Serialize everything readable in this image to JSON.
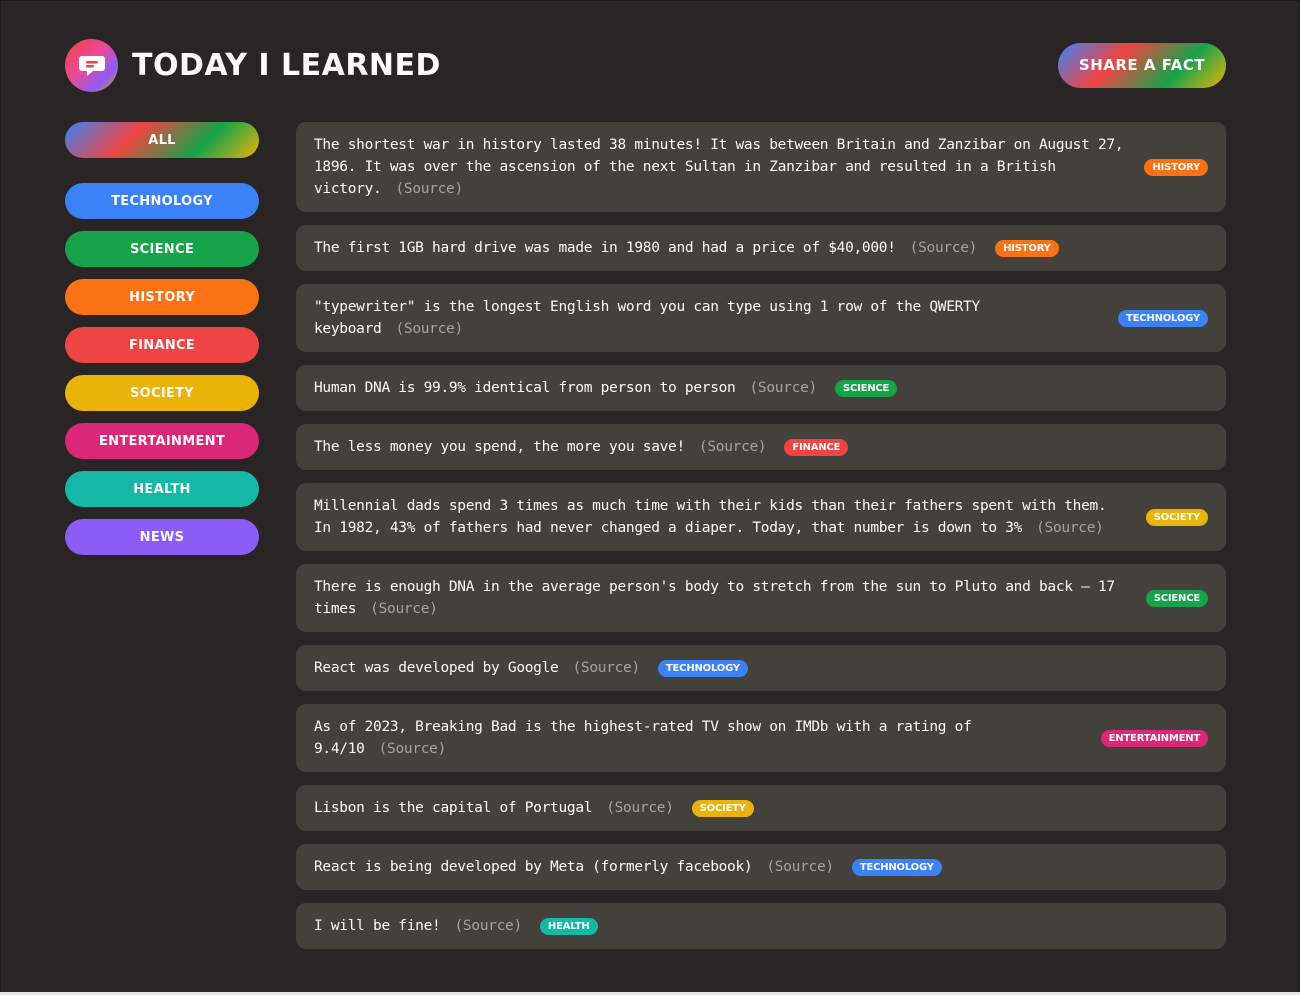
{
  "app": {
    "title": "Today I Learned",
    "share_label": "Share a fact"
  },
  "colors": {
    "background": "#292524",
    "card": "#44403c",
    "technology": "#3b82f6",
    "science": "#16a34a",
    "history": "#f97316",
    "finance": "#ef4444",
    "society": "#eab308",
    "entertainment": "#db2777",
    "health": "#14b8a6",
    "news": "#8b5cf6"
  },
  "sidebar": {
    "all_label": "All",
    "categories": [
      {
        "label": "Technology",
        "color": "#3b82f6"
      },
      {
        "label": "Science",
        "color": "#16a34a"
      },
      {
        "label": "History",
        "color": "#f97316"
      },
      {
        "label": "Finance",
        "color": "#ef4444"
      },
      {
        "label": "Society",
        "color": "#eab308"
      },
      {
        "label": "Entertainment",
        "color": "#db2777"
      },
      {
        "label": "Health",
        "color": "#14b8a6"
      },
      {
        "label": "News",
        "color": "#8b5cf6"
      }
    ]
  },
  "facts": [
    {
      "text": "The shortest war in history lasted 38 minutes! It was between Britain and Zanzibar on August 27, 1896. It was over the ascension of the next Sultan in Zanzibar and resulted in a British victory.",
      "source": "(Source)",
      "tag": "History",
      "tag_color": "#f97316",
      "inline": false
    },
    {
      "text": "The first 1GB hard drive was made in 1980 and had a price of $40,000!",
      "source": "(Source)",
      "tag": "History",
      "tag_color": "#f97316",
      "inline": true
    },
    {
      "text": "\"typewriter\" is the longest English word you can type using 1 row of the QWERTY keyboard",
      "source": "(Source)",
      "tag": "Technology",
      "tag_color": "#3b82f6",
      "inline": false
    },
    {
      "text": "Human DNA is 99.9% identical from person to person",
      "source": "(Source)",
      "tag": "Science",
      "tag_color": "#16a34a",
      "inline": true
    },
    {
      "text": "The less money you spend, the more you save!",
      "source": "(Source)",
      "tag": "Finance",
      "tag_color": "#ef4444",
      "inline": true
    },
    {
      "text": "Millennial dads spend 3 times as much time with their kids than their fathers spent with them. In 1982, 43% of fathers had never changed a diaper. Today, that number is down to 3%",
      "source": "(Source)",
      "tag": "Society",
      "tag_color": "#eab308",
      "inline": false
    },
    {
      "text": "There is enough DNA in the average person's body to stretch from the sun to Pluto and back — 17 times",
      "source": "(Source)",
      "tag": "Science",
      "tag_color": "#16a34a",
      "inline": false
    },
    {
      "text": "React was developed by Google",
      "source": "(Source)",
      "tag": "Technology",
      "tag_color": "#3b82f6",
      "inline": true
    },
    {
      "text": "As of 2023, Breaking Bad is the highest-rated TV show on IMDb with a rating of 9.4/10",
      "source": "(Source)",
      "tag": "Entertainment",
      "tag_color": "#db2777",
      "inline": false
    },
    {
      "text": "Lisbon is the capital of Portugal",
      "source": "(Source)",
      "tag": "Society",
      "tag_color": "#eab308",
      "inline": true
    },
    {
      "text": "React is being developed by Meta (formerly facebook)",
      "source": "(Source)",
      "tag": "Technology",
      "tag_color": "#3b82f6",
      "inline": true
    },
    {
      "text": "I will be fine!",
      "source": "(Source)",
      "tag": "Health",
      "tag_color": "#14b8a6",
      "inline": true
    }
  ]
}
